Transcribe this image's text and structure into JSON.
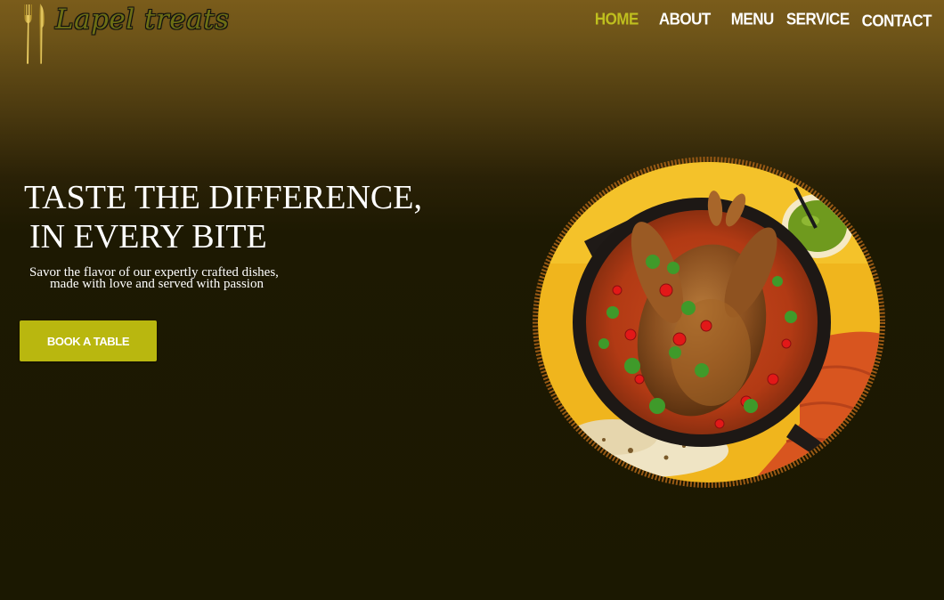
{
  "header": {
    "logo_text": "Lapel treats",
    "nav": [
      {
        "label": "HOME",
        "active": true
      },
      {
        "label": "ABOUT",
        "active": false
      },
      {
        "label": "MENU",
        "active": false
      },
      {
        "label": "SERVICE",
        "active": false
      },
      {
        "label": "CONTACT",
        "active": false
      }
    ]
  },
  "hero": {
    "title_line1": "TASTE THE DIFFERENCE,",
    "title_line2": "IN EVERY BITE",
    "subtitle_line1": "Savor the flavor of our expertly crafted dishes,",
    "subtitle_line2": "made with love and served with passion",
    "cta_label": "BOOK A TABLE"
  },
  "icons": {
    "logo": "fork-knife-icon",
    "hero_image": "roast-chicken-skillet-image"
  },
  "colors": {
    "accent": "#b9b70f",
    "nav_active": "#bfbf1e",
    "background_top": "#7a5c1b",
    "background_bottom": "#1b1801"
  }
}
